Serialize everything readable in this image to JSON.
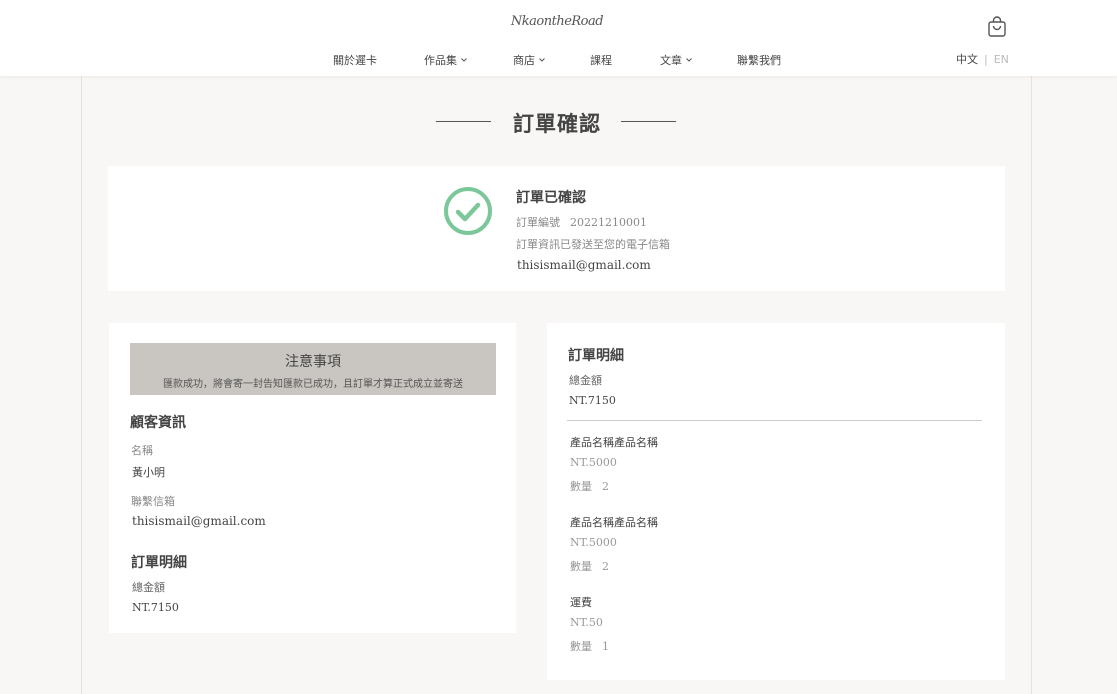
{
  "header": {
    "logo_text": "NkaontheRoad",
    "nav": [
      {
        "label": "關於遲卡",
        "has_dropdown": false
      },
      {
        "label": "作品集",
        "has_dropdown": true
      },
      {
        "label": "商店",
        "has_dropdown": true
      },
      {
        "label": "課程",
        "has_dropdown": false
      },
      {
        "label": "文章",
        "has_dropdown": true
      },
      {
        "label": "聯繫我們",
        "has_dropdown": false
      }
    ],
    "cart_icon": "shopping-bag-icon",
    "lang": {
      "zh": "中文",
      "separator": "|",
      "en": "EN"
    }
  },
  "page": {
    "title": "訂單確認"
  },
  "confirmation": {
    "icon": "check-circle-icon",
    "icon_color": "#7cc79a",
    "title": "訂單已確認",
    "order_no_label": "訂單編號",
    "order_no": "20221210001",
    "sent_message": "訂單資訊已發送至您的電子信箱",
    "email": "thisismail@gmail.com"
  },
  "left": {
    "notice": {
      "title": "注意事項",
      "text": "匯款成功，將會寄一封告知匯款已成功，且訂單才算正式成立並寄送"
    },
    "customer": {
      "section_title": "顧客資訊",
      "name_label": "名稱",
      "name": "黃小明",
      "email_label": "聯繫信箱",
      "email": "thisismail@gmail.com"
    },
    "order": {
      "section_title": "訂單明細",
      "total_label": "總金額",
      "total": "NT.7150"
    }
  },
  "right": {
    "section_title": "訂單明細",
    "total_label": "總金額",
    "total": "NT.7150",
    "items": [
      {
        "name": "產品名稱產品名稱",
        "price": "NT.5000",
        "qty_label": "數量",
        "qty": "2"
      },
      {
        "name": "產品名稱產品名稱",
        "price": "NT.5000",
        "qty_label": "數量",
        "qty": "2"
      },
      {
        "name": "運費",
        "price": "NT.50",
        "qty_label": "數量",
        "qty": "1"
      }
    ]
  }
}
